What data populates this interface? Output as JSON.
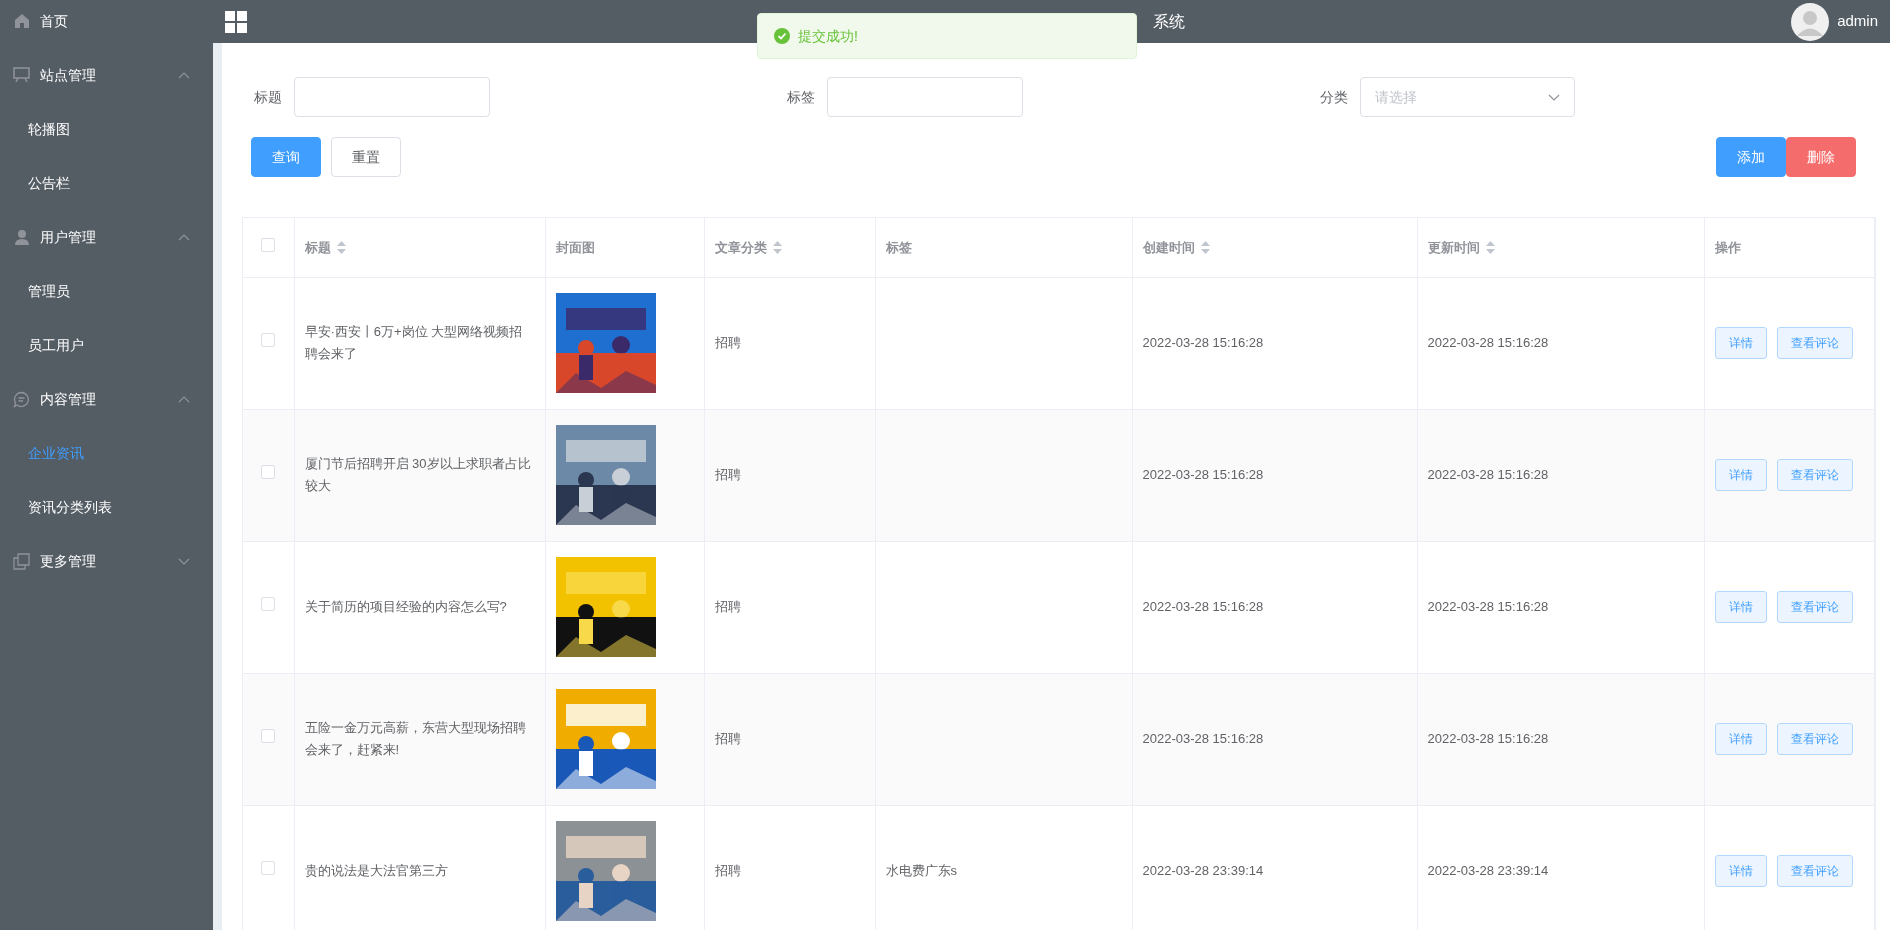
{
  "sidebar": {
    "items": [
      {
        "label": "首页",
        "selected": false
      },
      {
        "label": "站点管理",
        "expanded": true,
        "children": [
          {
            "label": "轮播图",
            "selected": false
          },
          {
            "label": "公告栏",
            "selected": false
          }
        ]
      },
      {
        "label": "用户管理",
        "expanded": true,
        "children": [
          {
            "label": "管理员",
            "selected": false
          },
          {
            "label": "员工用户",
            "selected": false
          }
        ]
      },
      {
        "label": "内容管理",
        "expanded": true,
        "children": [
          {
            "label": "企业资讯",
            "selected": true
          },
          {
            "label": "资讯分类列表",
            "selected": false
          }
        ]
      },
      {
        "label": "更多管理",
        "expanded": false
      }
    ]
  },
  "header": {
    "title": "系统",
    "user": "admin"
  },
  "toast": {
    "message": "提交成功!"
  },
  "filters": [
    {
      "label": "标题",
      "kind": "text"
    },
    {
      "label": "标签",
      "kind": "text"
    },
    {
      "label": "分类",
      "kind": "select",
      "placeholder": "请选择"
    }
  ],
  "buttons": [
    {
      "label": "查询",
      "kind": "primary"
    },
    {
      "label": "重置",
      "kind": "plain"
    }
  ],
  "actions": [
    {
      "label": "添加",
      "kind": "primary"
    },
    {
      "label": "删除",
      "kind": "danger"
    }
  ],
  "table": {
    "select_all": {
      "checked": false
    },
    "columns": [
      {
        "label": "标题",
        "sortable": true
      },
      {
        "label": "封面图",
        "sortable": false
      },
      {
        "label": "文章分类",
        "sortable": true
      },
      {
        "label": "标签",
        "sortable": false
      },
      {
        "label": "创建时间",
        "sortable": true
      },
      {
        "label": "更新时间",
        "sortable": true
      },
      {
        "label": "操作",
        "sortable": false
      }
    ],
    "rows": [
      {
        "checked": false,
        "title": "早安·西安丨6万+岗位 大型网络视频招聘会来了",
        "cover": {
          "kind": "picture"
        },
        "category": "招聘",
        "created": "2022-03-28 15:16:28",
        "updated": "2022-03-28 15:16:28",
        "buttons": [
          "详情",
          "查看评论"
        ]
      },
      {
        "checked": false,
        "title": "厦门节后招聘开启 30岁以上求职者占比较大",
        "cover": {
          "kind": "picture"
        },
        "category": "招聘",
        "created": "2022-03-28 15:16:28",
        "updated": "2022-03-28 15:16:28",
        "buttons": [
          "详情",
          "查看评论"
        ]
      },
      {
        "checked": false,
        "title": "关于简历的项目经验的内容怎么写?",
        "cover": {
          "kind": "picture"
        },
        "category": "招聘",
        "created": "2022-03-28 15:16:28",
        "updated": "2022-03-28 15:16:28",
        "buttons": [
          "详情",
          "查看评论"
        ]
      },
      {
        "checked": false,
        "title": "五险一金万元高薪，东营大型现场招聘会来了，赶紧来!",
        "cover": {
          "kind": "picture"
        },
        "category": "招聘",
        "created": "2022-03-28 15:16:28",
        "updated": "2022-03-28 15:16:28",
        "buttons": [
          "详情",
          "查看评论"
        ]
      },
      {
        "checked": false,
        "title": "贵的说法是大法官第三方",
        "cover": {
          "kind": "picture"
        },
        "category": "招聘",
        "tag": "水电费广东s",
        "created": "2022-03-28 23:39:14",
        "updated": "2022-03-28 23:39:14",
        "buttons": [
          "详情",
          "查看评论"
        ]
      }
    ]
  }
}
